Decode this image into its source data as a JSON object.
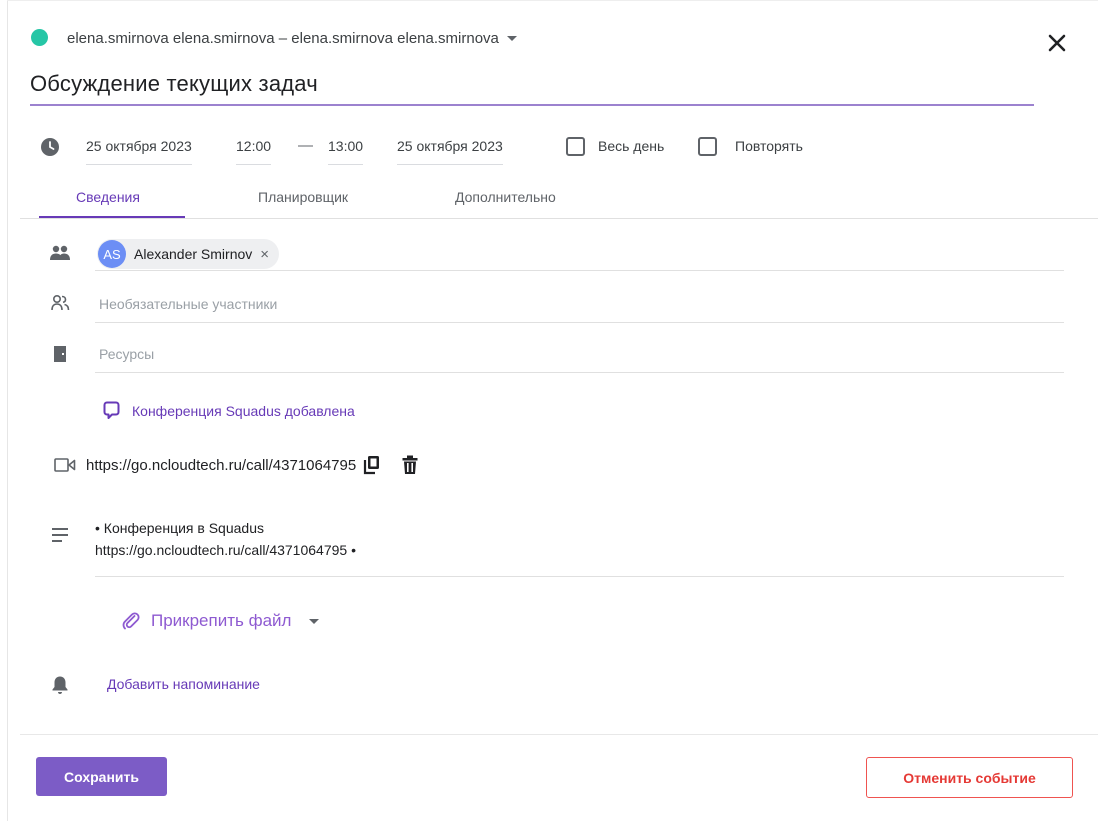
{
  "header": {
    "account_label": "elena.smirnova elena.smirnova – elena.smirnova elena.smirnova",
    "status_color": "#26c6a6",
    "close_icon": "close-icon"
  },
  "event": {
    "title": "Обсуждение текущих задач"
  },
  "datetime": {
    "start_date": "25 октября 2023",
    "start_time": "12:00",
    "separator": "—",
    "end_time": "13:00",
    "end_date": "25 октября 2023",
    "all_day_label": "Весь день",
    "all_day_checked": false,
    "repeat_label": "Повторять",
    "repeat_checked": false
  },
  "tabs": [
    {
      "label": "Сведения",
      "active": true
    },
    {
      "label": "Планировщик",
      "active": false
    },
    {
      "label": "Дополнительно",
      "active": false
    }
  ],
  "participants": {
    "required": [
      {
        "initials": "AS",
        "name": "Alexander Smirnov"
      }
    ],
    "remove_glyph": "×",
    "optional_placeholder": "Необязательные участники",
    "resources_placeholder": "Ресурсы"
  },
  "conference": {
    "status": "Конференция Squadus добавлена",
    "url": "https://go.ncloudtech.ru/call/4371064795"
  },
  "description": {
    "line1": "• Конференция в Squadus",
    "line2": "https://go.ncloudtech.ru/call/4371064795 •"
  },
  "attach": {
    "label": "Прикрепить файл"
  },
  "reminder": {
    "label": "Добавить напоминание"
  },
  "footer": {
    "save_label": "Сохранить",
    "cancel_event_label": "Отменить событие"
  },
  "colors": {
    "accent": "#673ab7",
    "save_button": "#7c5cc6",
    "danger": "#e53935",
    "avatar": "#6c8ef5"
  }
}
